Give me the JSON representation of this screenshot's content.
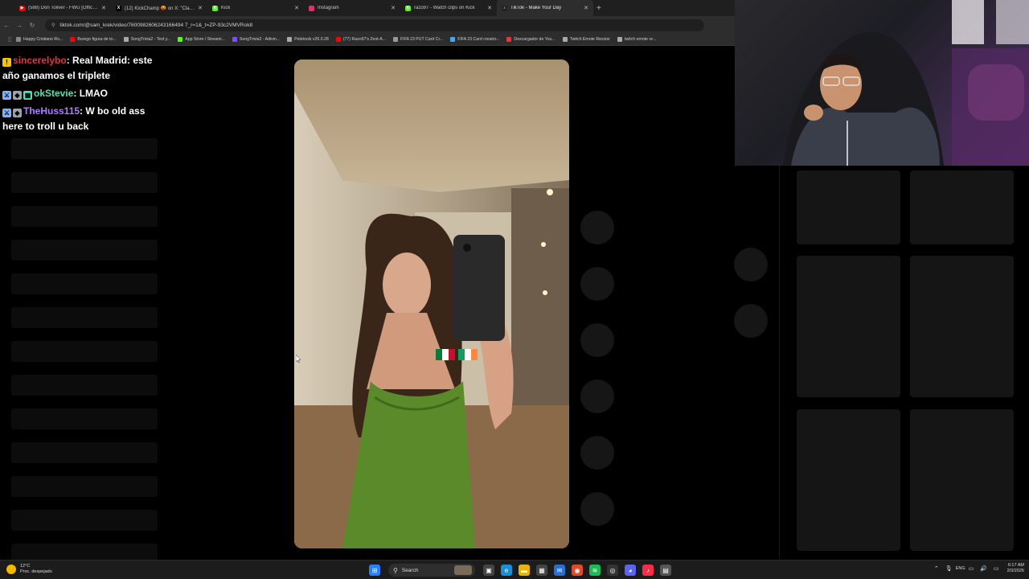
{
  "browser": {
    "tabs": [
      {
        "title": "(588) Don Toliver - FWU [Offici…",
        "color": "#ff0000",
        "glyph": "▶",
        "active": false
      },
      {
        "title": "(12) KickChamp 🤬 on X: \"Cla…",
        "color": "#000000",
        "glyph": "X",
        "active": false
      },
      {
        "title": "Kick",
        "color": "#53fc18",
        "glyph": "K",
        "active": false
      },
      {
        "title": "Instagram",
        "color": "#e1306c",
        "glyph": "",
        "active": false
      },
      {
        "title": "razo97 - Watch clips on Kick",
        "color": "#53fc18",
        "glyph": "K",
        "active": false
      },
      {
        "title": "TikTok - Make Your Day",
        "color": "#222222",
        "glyph": "♪",
        "active": true
      }
    ],
    "new_tab": "+",
    "url": "tiktok.com/@sam_krek/video/7600982606243166494 7_r=1&_t=ZP-93c2VMVRok8",
    "bookmarks": [
      {
        "label": "Happy Cristiano Ro...",
        "color": "#888888"
      },
      {
        "label": "Burego figura de to...",
        "color": "#ff0000"
      },
      {
        "label": "SongTrivia2 - Test y...",
        "color": "#aaaaaa"
      },
      {
        "label": "App Store / Streami...",
        "color": "#53fc18"
      },
      {
        "label": "SongTrivia2 - Adivin...",
        "color": "#7b4fff"
      },
      {
        "label": "Peletools v26.0.28",
        "color": "#aaaaaa"
      },
      {
        "label": "(77) Razo97's Zest-A...",
        "color": "#ff0000"
      },
      {
        "label": "FIFA 23 PUT Card Cr...",
        "color": "#999999"
      },
      {
        "label": "FIFA 23 Card creator...",
        "color": "#3fa9f5"
      },
      {
        "label": "Descargador de You...",
        "color": "#e53935"
      },
      {
        "label": "Twitch Emote Resizer",
        "color": "#aaaaaa"
      },
      {
        "label": "twitch emote re...",
        "color": "#aaaaaa"
      }
    ]
  },
  "chat": [
    {
      "badges": [
        {
          "color": "#f5c400",
          "glyph": "!"
        }
      ],
      "user": "sincerelybo",
      "user_color": "#e5343a",
      "text": ": Real Madrid: este año ganamos el triplete"
    },
    {
      "badges": [
        {
          "color": "#7fb3ff",
          "glyph": "⚔"
        },
        {
          "color": "#9aa3ad",
          "glyph": "◆"
        },
        {
          "color": "#53e0b3",
          "glyph": "▦"
        }
      ],
      "user": "okStevie",
      "user_color": "#53e0b3",
      "text": ": LMAO"
    },
    {
      "badges": [
        {
          "color": "#7fb3ff",
          "glyph": "⚔"
        },
        {
          "color": "#9aa3ad",
          "glyph": "◆"
        }
      ],
      "user": "TheHuss115",
      "user_color": "#b07cff",
      "text": ": W bo old ass here to troll u back"
    }
  ],
  "taskbar": {
    "weather_temp": "12°C",
    "weather_desc": "Proc. despejado",
    "search_label": "Search",
    "lang": "ENG",
    "time": "6:17 AM",
    "date": "2/3/2026"
  }
}
